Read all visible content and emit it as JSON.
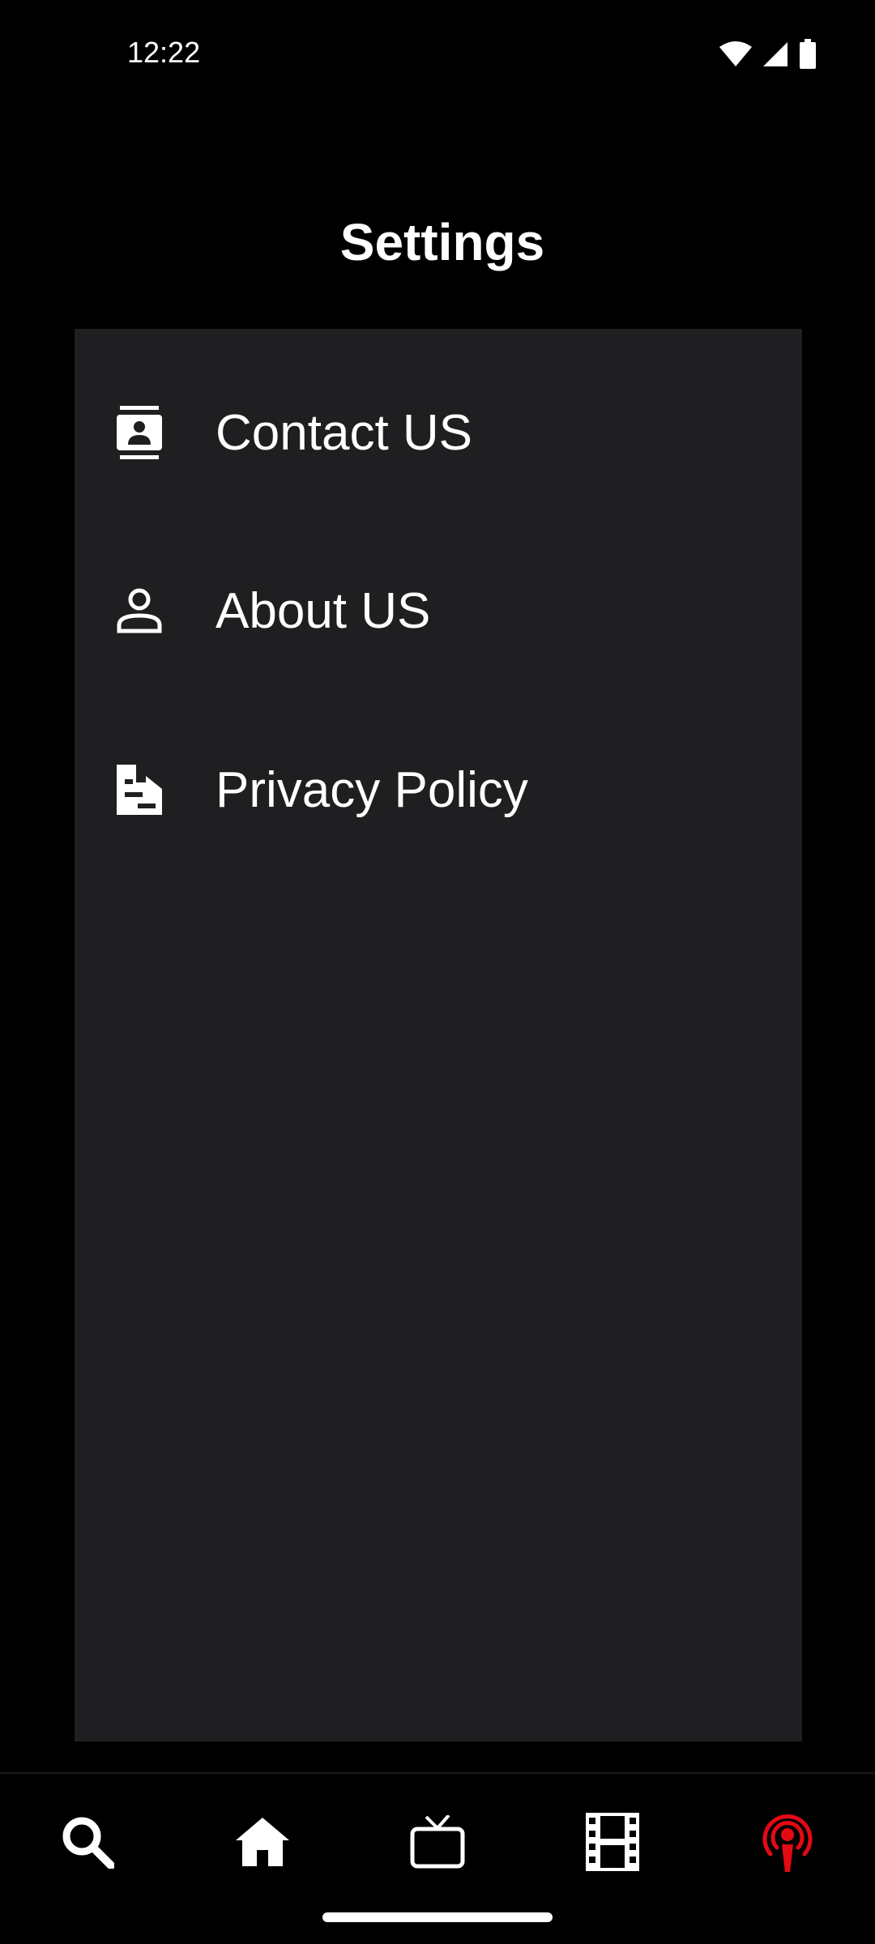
{
  "status_bar": {
    "time": "12:22",
    "icons": [
      "wifi-icon",
      "cellular-signal-icon",
      "battery-icon"
    ]
  },
  "header": {
    "title": "Settings"
  },
  "settings": {
    "items": [
      {
        "label": "Contact US",
        "icon": "contact-card-icon"
      },
      {
        "label": "About US",
        "icon": "person-icon"
      },
      {
        "label": "Privacy Policy",
        "icon": "policy-document-icon"
      }
    ]
  },
  "bottom_nav": {
    "items": [
      {
        "icon": "search-icon",
        "active": false
      },
      {
        "icon": "home-icon",
        "active": false
      },
      {
        "icon": "tv-icon",
        "active": false
      },
      {
        "icon": "film-strip-icon",
        "active": false
      },
      {
        "icon": "podcast-icon",
        "active": true
      }
    ]
  },
  "colors": {
    "background": "#000000",
    "panel": "#1f1e21",
    "text": "#ffffff",
    "accent": "#e50914"
  }
}
